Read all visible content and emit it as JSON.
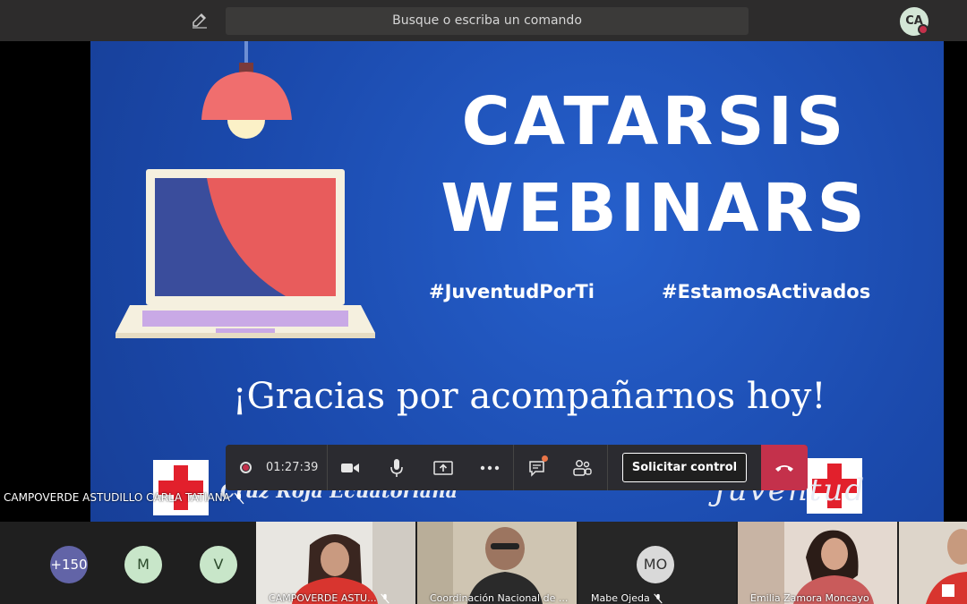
{
  "search": {
    "placeholder": "Busque o escriba un comando"
  },
  "user": {
    "initials": "CA",
    "presence_color": "#c4314b"
  },
  "slide": {
    "title_line1": "CATARSIS",
    "title_line2": "WEBINARS",
    "hashtag1": "#JuventudPorTi",
    "hashtag2": "#EstamosActivados",
    "thanks": "¡Gracias por acompañarnos hoy!",
    "brand_left": "Cruz Roja Ecuatoriana",
    "brand_right": "Juventud",
    "background_color": "#1e4fb5"
  },
  "toolbar": {
    "timer": "01:27:39",
    "request_control": "Solicitar control",
    "hangup_color": "#c4314b"
  },
  "presenter": {
    "name": "CAMPOVERDE ASTUDILLO CARLA TATIANA"
  },
  "participants": {
    "more_count": "+150",
    "avatar1": "M",
    "avatar2": "V",
    "tile1_name": "CAMPOVERDE ASTU...",
    "tile2_name": "Coordinación Nacional de ...",
    "tile3_initials": "MO",
    "tile3_name": "Mabe Ojeda",
    "tile4_name": "Emilia Zamora Moncayo"
  }
}
